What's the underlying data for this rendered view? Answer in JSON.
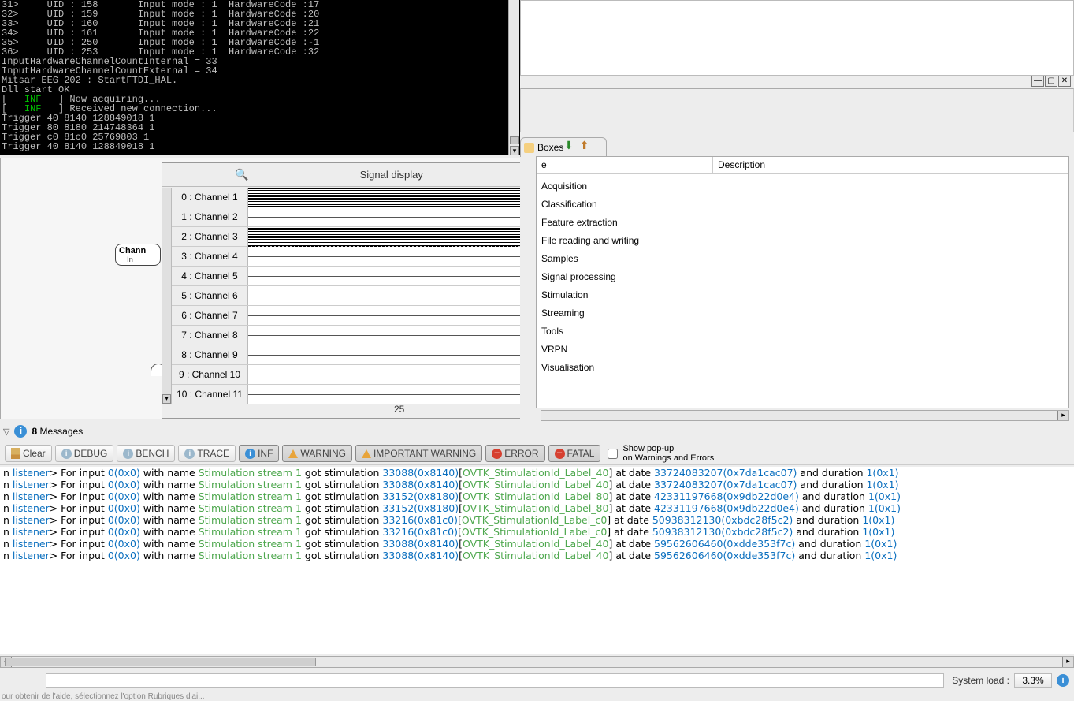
{
  "console": {
    "lines": [
      "31>     UID : 158       Input mode : 1  HardwareCode :17",
      "32>     UID : 159       Input mode : 1  HardwareCode :20",
      "33>     UID : 160       Input mode : 1  HardwareCode :21",
      "34>     UID : 161       Input mode : 1  HardwareCode :22",
      "35>     UID : 250       Input mode : 1  HardwareCode :-1",
      "36>     UID : 253       Input mode : 1  HardwareCode :32",
      "InputHardwareChannelCountInternal = 33",
      "InputHardwareChannelCountExternal = 34",
      "Mitsar EEG 202 : StartFTDI_HAL.",
      "Dll start OK",
      "[   INF   ] Now acquiring...",
      "[   INF   ] Received new connection...",
      "Trigger 40 8140 128849018 1",
      "Trigger 80 8180 214748364 1",
      "Trigger c0 81c0 25769803 1",
      "Trigger 40 8140 128849018 1"
    ]
  },
  "canvas": {
    "node_title": "Chann",
    "node_sub": "In"
  },
  "signal": {
    "title": "Signal display",
    "channels": [
      "0 : Channel 1",
      "1 : Channel 2",
      "2 : Channel 3",
      "3 : Channel 4",
      "4 : Channel 5",
      "5 : Channel 6",
      "6 : Channel 7",
      "7 : Channel 8",
      "8 : Channel 9",
      "9 : Channel 10",
      "10 : Channel 11"
    ],
    "xaxis": "25"
  },
  "boxes": {
    "tab_label": "Boxes",
    "header_name": "e",
    "header_desc": "Description",
    "categories": [
      "Acquisition",
      "Classification",
      "Feature extraction",
      "File reading and writing",
      "Samples",
      "Signal processing",
      "Stimulation",
      "Streaming",
      "Tools",
      "VRPN",
      "Visualisation"
    ]
  },
  "messages": {
    "count": "8",
    "label": "Messages",
    "toolbar": {
      "clear": "Clear",
      "debug": "DEBUG",
      "bench": "BENCH",
      "trace": "TRACE",
      "inf": "INF",
      "warning": "WARNING",
      "important_warning": "IMPORTANT WARNING",
      "error": "ERROR",
      "fatal": "FATAL",
      "popup_l1": "Show pop-up",
      "popup_l2": "on Warnings and Errors"
    }
  },
  "log": [
    {
      "code": "33088(0x8140)",
      "label": "OVTK_StimulationId_Label_40",
      "date": "33724083207(0x7da1cac07)"
    },
    {
      "code": "33088(0x8140)",
      "label": "OVTK_StimulationId_Label_40",
      "date": "33724083207(0x7da1cac07)"
    },
    {
      "code": "33152(0x8180)",
      "label": "OVTK_StimulationId_Label_80",
      "date": "42331197668(0x9db22d0e4)"
    },
    {
      "code": "33152(0x8180)",
      "label": "OVTK_StimulationId_Label_80",
      "date": "42331197668(0x9db22d0e4)"
    },
    {
      "code": "33216(0x81c0)",
      "label": "OVTK_StimulationId_Label_c0",
      "date": "50938312130(0xbdc28f5c2)"
    },
    {
      "code": "33216(0x81c0)",
      "label": "OVTK_StimulationId_Label_c0",
      "date": "50938312130(0xbdc28f5c2)"
    },
    {
      "code": "33088(0x8140)",
      "label": "OVTK_StimulationId_Label_40",
      "date": "59562606460(0xdde353f7c)"
    },
    {
      "code": "33088(0x8140)",
      "label": "OVTK_StimulationId_Label_40",
      "date": "59562606460(0xdde353f7c)"
    }
  ],
  "log_common": {
    "listener": "listener",
    "for_input": "> For input ",
    "input_id": "0(0x0)",
    "with_name": " with name ",
    "stream": "Stimulation stream 1",
    "got": " got stimulation ",
    "at_date": " at date ",
    "and_dur": " and duration ",
    "dur": "1(0x1)"
  },
  "status": {
    "label": "System load :",
    "value": "3.3%"
  },
  "footer": "our obtenir de l'aide, sélectionnez l'option Rubriques d'ai..."
}
